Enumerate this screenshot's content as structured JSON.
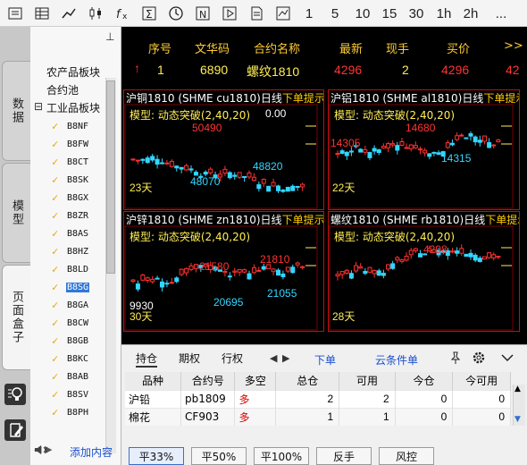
{
  "toolbar": {
    "items": [
      {
        "name": "list-icon"
      },
      {
        "name": "grid-icon"
      },
      {
        "name": "line-chart-icon"
      },
      {
        "name": "candlestick-icon"
      },
      {
        "name": "formula-icon"
      },
      {
        "name": "sigma-icon"
      },
      {
        "name": "clock-icon"
      },
      {
        "name": "news-icon"
      },
      {
        "name": "play-icon"
      },
      {
        "name": "document-icon"
      },
      {
        "name": "trend-icon"
      }
    ],
    "periods": [
      "1",
      "5",
      "10",
      "15",
      "30",
      "1h",
      "2h",
      "..."
    ]
  },
  "left_tabs": [
    "数据",
    "模型",
    "页面盒子"
  ],
  "sidebar": {
    "pin": "⊥",
    "groups": [
      "农产品板块",
      "合约池",
      "工业品板块"
    ],
    "expander": "⊟",
    "leaves": [
      "B8NF",
      "B8FW",
      "B8CT",
      "B8SK",
      "B8GX",
      "B8ZR",
      "B8AS",
      "B8HZ",
      "B8LD",
      "B8SG",
      "B8GA",
      "B8CW",
      "B8GB",
      "B8KC",
      "B8AB",
      "B8SV",
      "B8PH"
    ],
    "selected_index": 9,
    "add_content": "添加内容"
  },
  "quote": {
    "headers": [
      "序号",
      "文华码",
      "合约名称",
      "最新",
      "现手",
      "买价",
      ">>"
    ],
    "row": {
      "arrow": "↑",
      "index": "1",
      "code": "6890",
      "name": "螺纹1810",
      "last": "4296",
      "volume": "2",
      "bid": "4296",
      "extra": "42"
    }
  },
  "panels": [
    {
      "title": "沪铜1810 (SHME cu1810)日线",
      "tip": "下单提示",
      "model": "模型: 动态突破(2,40,20)",
      "aux": "0.00",
      "labels": {
        "high": "50490",
        "mid": "48820",
        "low": "48070",
        "days": "23天"
      }
    },
    {
      "title": "沪铝1810 (SHME al1810)日线",
      "tip": "下单提示",
      "model": "模型: 动态突破(2,40,20)",
      "aux": "",
      "labels": {
        "high": "14680",
        "mid": "14315",
        "low": "14305",
        "days": "22天"
      }
    },
    {
      "title": "沪锌1810 (SHME zn1810)日线",
      "tip": "下单提示",
      "model": "模型: 动态突破(2,40,20)",
      "aux": "",
      "labels": {
        "high": "21810",
        "high2": "21580",
        "mid": "21055",
        "low": "20695",
        "low2": "9930",
        "days": "30天"
      }
    },
    {
      "title": "螺纹1810 (SHME rb1810)日线",
      "tip": "下单提示",
      "model": "模型: 动态突破(2,40,20)",
      "aux": "",
      "labels": {
        "high": "4298",
        "days": "28天"
      }
    }
  ],
  "bottom": {
    "tabs": [
      "持仓",
      "期权",
      "行权"
    ],
    "links": [
      "下单",
      "云条件单"
    ],
    "icons": [
      "pin-icon",
      "settings-icon",
      "collapse-icon"
    ],
    "columns": [
      "品种",
      "合约号",
      "多空",
      "总仓",
      "可用",
      "今仓",
      "今可用"
    ],
    "rows": [
      [
        "沪铅",
        "pb1809",
        "多",
        "2",
        "2",
        "0",
        "0"
      ],
      [
        "棉花",
        "CF903",
        "多",
        "1",
        "1",
        "0",
        "0"
      ]
    ],
    "buttons": [
      "平33%",
      "平50%",
      "平100%",
      "反手",
      "风控"
    ]
  }
}
